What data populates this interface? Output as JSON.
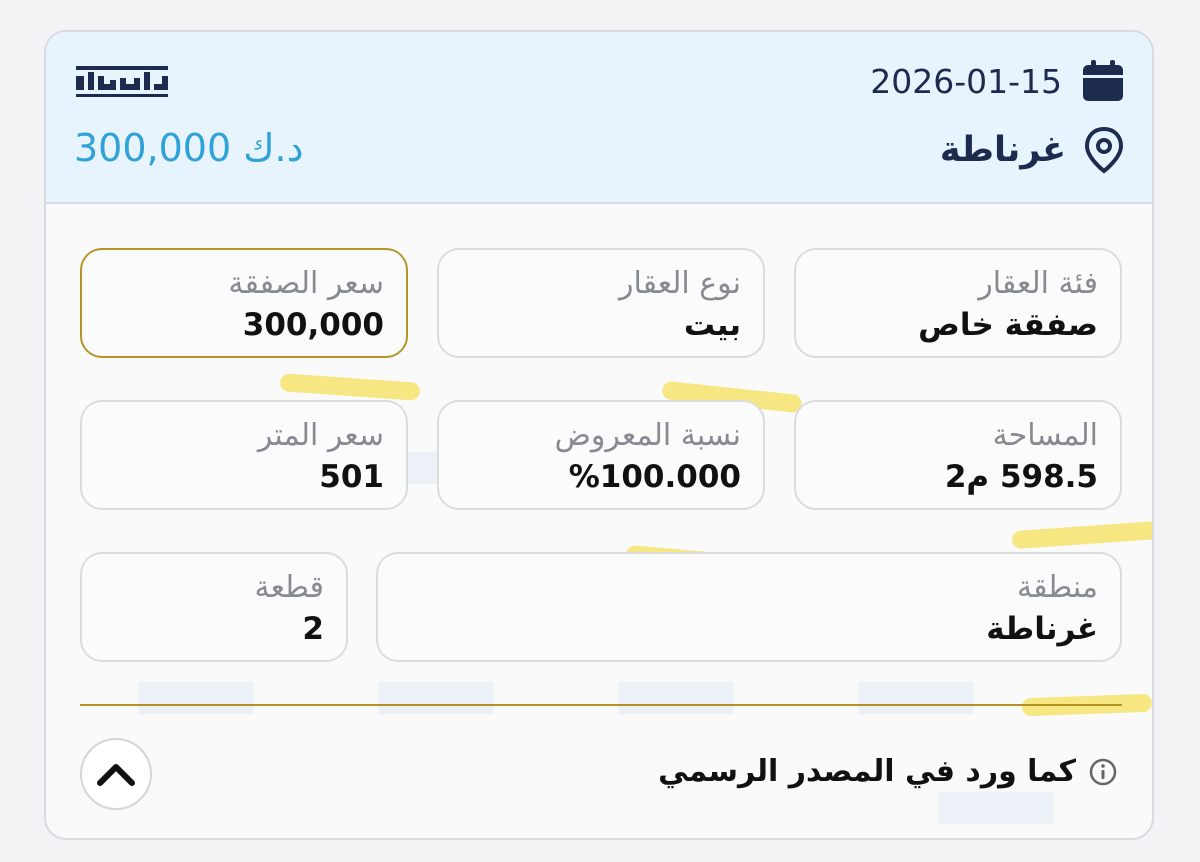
{
  "header": {
    "date": "2026-01-15",
    "location": "غرناطة",
    "price": "300,000 د.ك",
    "logo_text": "الحسبة",
    "icons": {
      "date": "calendar-icon",
      "location": "map-pin-icon"
    }
  },
  "fields": {
    "category": {
      "label": "فئة العقار",
      "value": "صفقة خاص"
    },
    "type": {
      "label": "نوع العقار",
      "value": "بيت"
    },
    "deal_price": {
      "label": "سعر الصفقة",
      "value": "300,000"
    },
    "area": {
      "label": "المساحة",
      "value": "598.5 م2"
    },
    "offered_ratio": {
      "label": "نسبة المعروض",
      "value": "%100.000"
    },
    "meter_price": {
      "label": "سعر المتر",
      "value": "501"
    },
    "region": {
      "label": "منطقة",
      "value": "غرناطة"
    },
    "plot": {
      "label": "قطعة",
      "value": "2"
    }
  },
  "footer": {
    "source_note": "كما ورد في المصدر الرسمي",
    "icons": {
      "info": "info-icon",
      "collapse": "chevron-up-icon"
    }
  },
  "colors": {
    "header_bg": "#e7f3fd",
    "price_accent": "#2fa2d8",
    "navy": "#1d2b4f",
    "gold": "#b5962c",
    "highlight": "#f6e05a"
  }
}
